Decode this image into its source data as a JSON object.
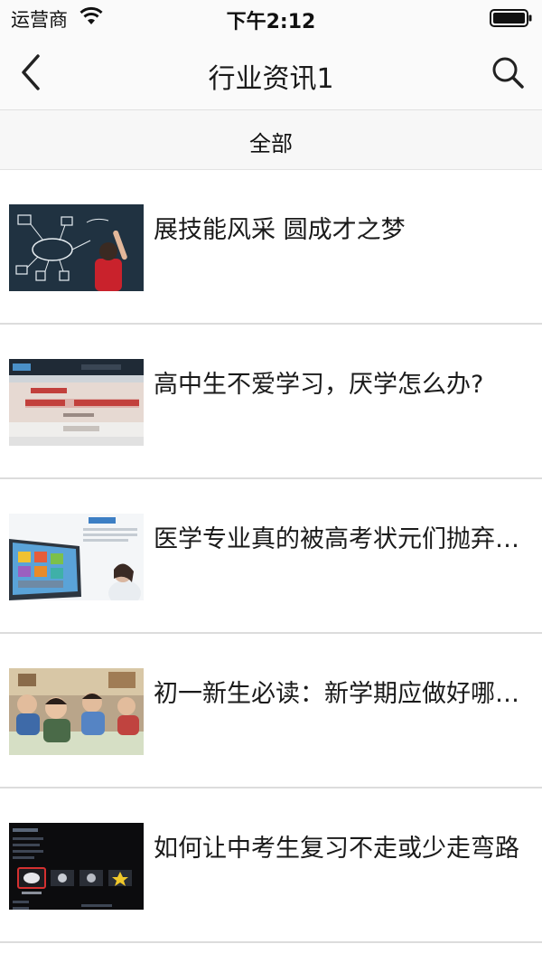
{
  "status_bar": {
    "carrier": "运营商",
    "time": "下午2:12"
  },
  "nav": {
    "title": "行业资讯1",
    "back_icon": "chevron-left-icon",
    "search_icon": "search-icon"
  },
  "filter": {
    "tab": "全部"
  },
  "news": [
    {
      "title": "展技能风采 圆成才之梦",
      "thumb": "blackboard-diagram"
    },
    {
      "title": "高中生不爱学习，厌学怎么办?",
      "thumb": "website-banner"
    },
    {
      "title": "医学专业真的被高考状元们抛弃了吗",
      "thumb": "tablet-with-woman"
    },
    {
      "title": "初一新生必读：新学期应做好哪些准备",
      "thumb": "classroom-children"
    },
    {
      "title": "如何让中考生复习不走或少走弯路",
      "thumb": "dark-app-menu"
    }
  ],
  "colors": {
    "background": "#ffffff",
    "bar": "#fafafa",
    "divider": "#dcdcdc",
    "text": "#1a1a1a"
  }
}
